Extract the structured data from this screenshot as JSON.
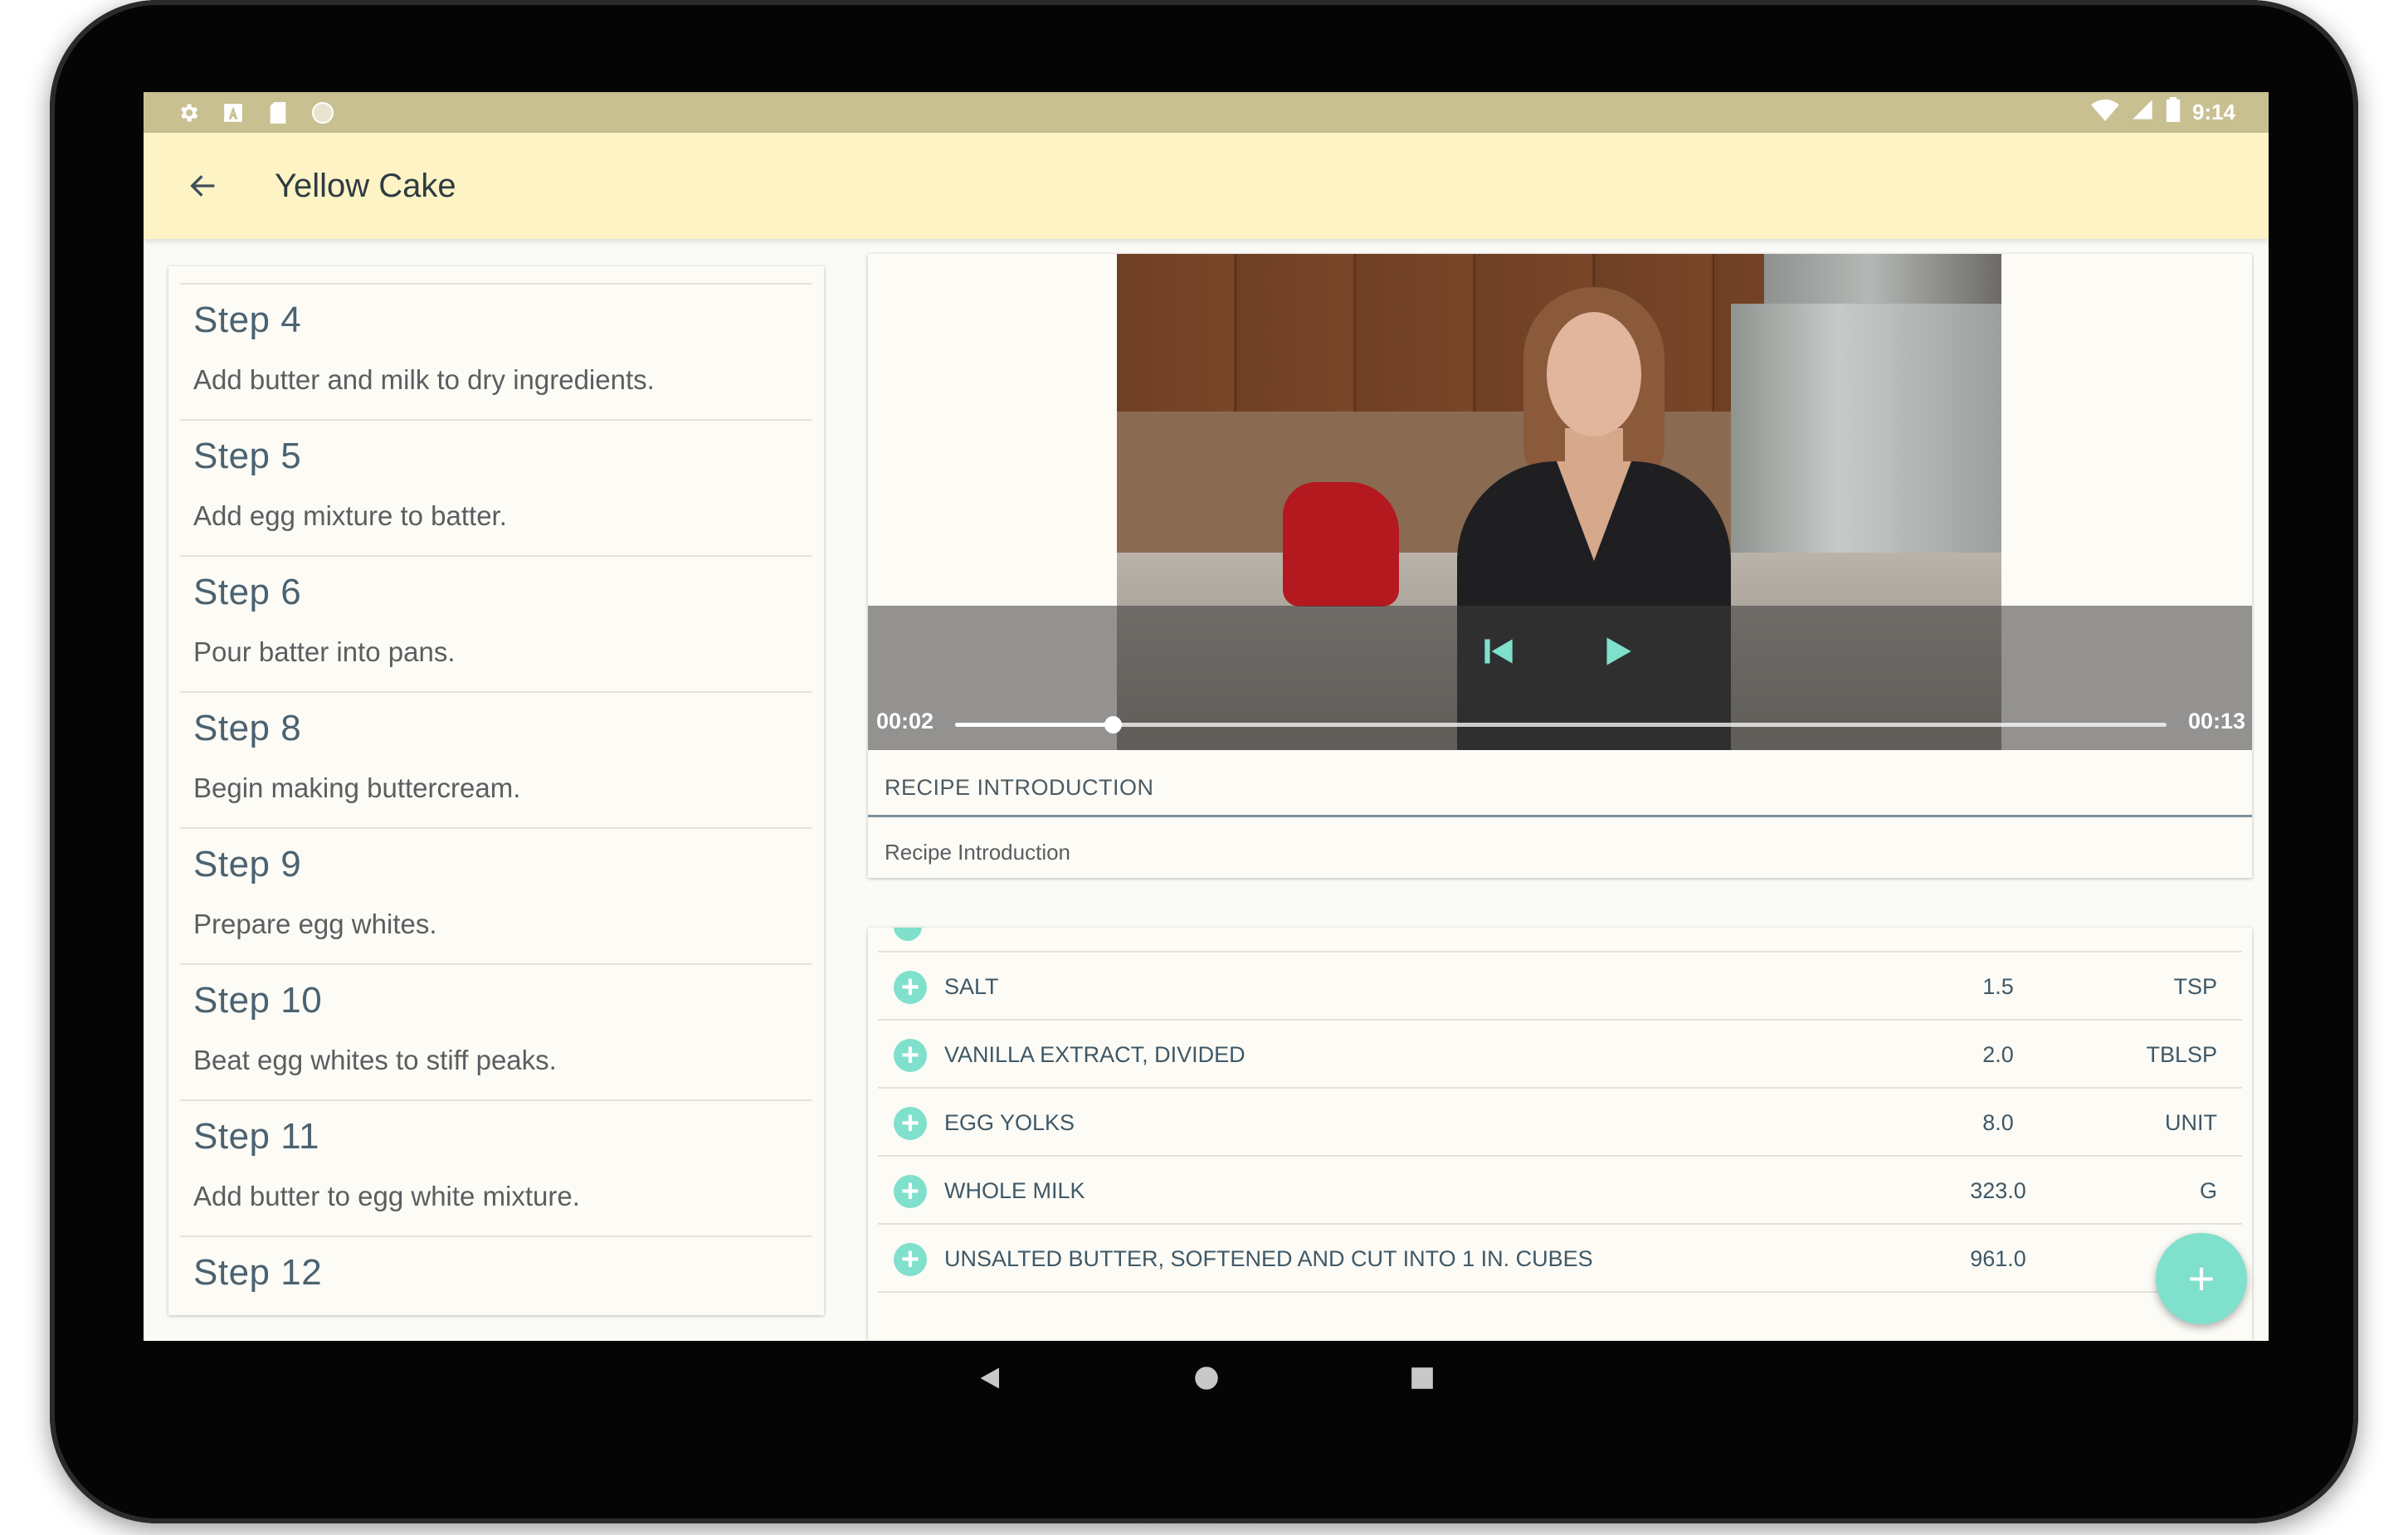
{
  "status_bar": {
    "time": "9:14",
    "left_icons": [
      "gear-icon",
      "a-icon",
      "sd-card-icon",
      "circle-icon"
    ],
    "right_icons": [
      "wifi-icon",
      "signal-icon",
      "battery-icon"
    ]
  },
  "app_bar": {
    "title": "Yellow Cake",
    "back_icon": "arrow-left-icon"
  },
  "steps": [
    {
      "title": "Step 4",
      "description": "Add butter and milk to dry ingredients."
    },
    {
      "title": "Step 5",
      "description": "Add egg mixture to batter."
    },
    {
      "title": "Step 6",
      "description": "Pour batter into pans."
    },
    {
      "title": "Step 8",
      "description": "Begin making buttercream."
    },
    {
      "title": "Step 9",
      "description": "Prepare egg whites."
    },
    {
      "title": "Step 10",
      "description": "Beat egg whites to stiff peaks."
    },
    {
      "title": "Step 11",
      "description": "Add butter to egg white mixture."
    },
    {
      "title": "Step 12",
      "description": ""
    }
  ],
  "player": {
    "current_time": "00:02",
    "total_time": "00:13",
    "progress": 0.13,
    "controls": [
      "skip-previous-icon",
      "play-icon"
    ]
  },
  "current_step": {
    "short_description": "RECIPE INTRODUCTION",
    "description": "Recipe Introduction"
  },
  "ingredients": [
    {
      "name": "SALT",
      "quantity": "1.5",
      "unit": "TSP"
    },
    {
      "name": "VANILLA EXTRACT, DIVIDED",
      "quantity": "2.0",
      "unit": "TBLSP"
    },
    {
      "name": "EGG YOLKS",
      "quantity": "8.0",
      "unit": "UNIT"
    },
    {
      "name": "WHOLE MILK",
      "quantity": "323.0",
      "unit": "G"
    },
    {
      "name": "UNSALTED BUTTER, SOFTENED AND CUT INTO 1 IN. CUBES",
      "quantity": "961.0",
      "unit": ""
    }
  ],
  "fab": {
    "label": "+",
    "icon": "plus-icon"
  },
  "nav_bar": {
    "buttons": [
      "back-triangle-icon",
      "home-circle-icon",
      "recents-square-icon"
    ]
  },
  "colors": {
    "status_bar": "#c9c092",
    "app_bar": "#fdf3c4",
    "accent": "#7fe0cc",
    "text_primary": "#4b6270"
  }
}
